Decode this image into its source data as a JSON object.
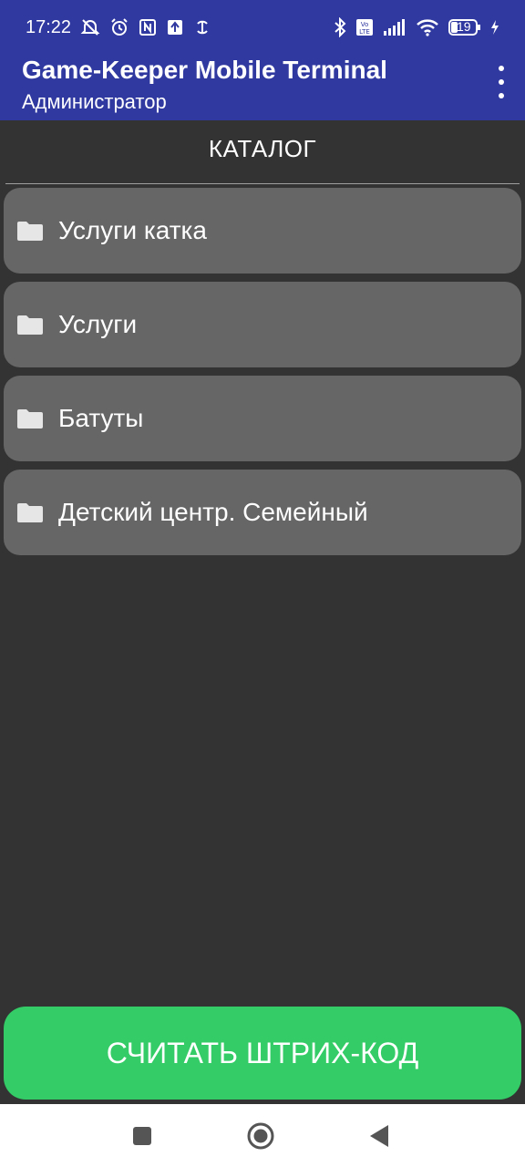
{
  "status_bar": {
    "time": "17:22",
    "battery_level": "19",
    "left_icons": [
      "muted-bell-icon",
      "alarm-icon",
      "nfc-icon",
      "upload-icon",
      "sync-icon"
    ],
    "right_icons": [
      "bluetooth-icon",
      "volte-icon",
      "signal-icon",
      "wifi-icon",
      "battery-icon",
      "charging-icon"
    ]
  },
  "app_bar": {
    "title": "Game-Keeper Mobile Terminal",
    "subtitle": "Администратор",
    "menu_icon": "more-vertical-icon",
    "color": "#3039a0"
  },
  "catalog": {
    "title": "КАТАЛОГ",
    "items": [
      {
        "label": "Услуги катка",
        "icon": "folder-icon"
      },
      {
        "label": "Услуги",
        "icon": "folder-icon"
      },
      {
        "label": "Батуты",
        "icon": "folder-icon"
      },
      {
        "label": "Детский центр. Семейный",
        "icon": "folder-icon"
      }
    ]
  },
  "scan_button": {
    "label": "СЧИТАТЬ ШТРИХ-КОД",
    "color": "#33cc66"
  },
  "nav_bar": {
    "buttons": [
      "recent-apps-icon",
      "home-icon",
      "back-icon"
    ]
  }
}
